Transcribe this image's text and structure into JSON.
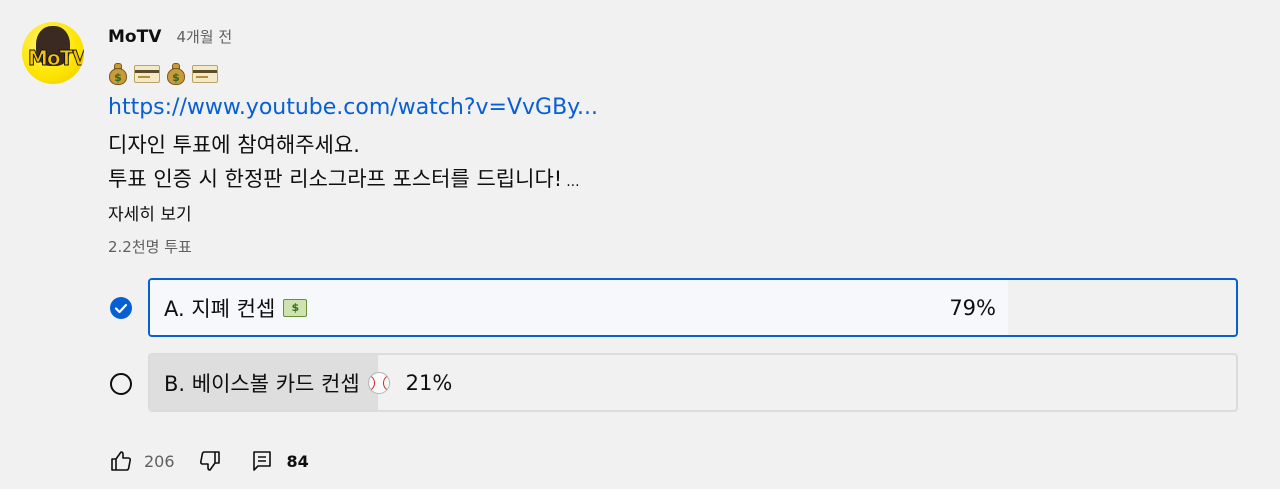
{
  "post": {
    "author": "MoTV",
    "time": "4개월 전",
    "emoji_row": [
      "money-bag",
      "credit-card",
      "money-bag",
      "credit-card"
    ],
    "link": "https://www.youtube.com/watch?v=VvGBy...",
    "line1": "디자인 투표에 참여해주세요.",
    "line2": "투표 인증 시 한정판 리소그라프 포스터를 드립니다!",
    "ellipsis": "...",
    "show_more": "자세히 보기"
  },
  "poll": {
    "votes": "2.2천명 투표",
    "options": [
      {
        "label": "A. 지폐 컨셉",
        "emoji": "banknote",
        "percent_text": "79%",
        "percent": 79,
        "selected": true
      },
      {
        "label": "B. 베이스볼 카드 컨셉",
        "emoji": "baseball",
        "percent_text": "21%",
        "percent": 21,
        "selected": false
      }
    ]
  },
  "actions": {
    "likes": "206",
    "comments": "84"
  },
  "colors": {
    "accent": "#065fd4",
    "background": "#f1f1f1",
    "secondary_text": "#606060"
  }
}
